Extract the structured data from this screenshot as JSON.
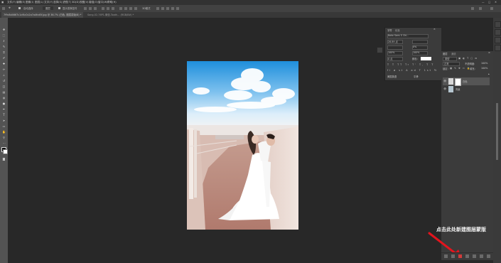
{
  "menubar": {
    "items": [
      "文件(F)",
      "编辑(E)",
      "图像(I)",
      "图层(L)",
      "文字(Y)",
      "选择(S)",
      "滤镜(T)",
      "3D(D)",
      "视图(V)",
      "增强(O)",
      "窗口(W)",
      "帮助(H)"
    ]
  },
  "options": {
    "auto_select_label": "自动选择",
    "layer_label": "图层",
    "transform_label": "显示变换控件",
    "mode_label": "3D模式"
  },
  "tabs": [
    {
      "label": "7f9c8d4667c1cf4c0c2a7a4fcd5f.jpg @ 36.7% (白色, 图层蒙版/8) *",
      "active": true
    },
    {
      "label": "Song-02-76P1-微信-Tooth... (RGB/8#) *",
      "active": false
    }
  ],
  "char_panel": {
    "tab1": "字符",
    "tab2": "段落",
    "font_value": "Noto Sans S Chi...",
    "size_value": "28.89 点",
    "leading_value": "0%",
    "tracking_value": "100%",
    "scale_value": "100%",
    "baseline_value": "0 点",
    "color_label": "颜色:",
    "lang_value": "美国英语",
    "aa_value": "平滑"
  },
  "layers_panel": {
    "tab_layers": "图层",
    "tab_paths": "通道",
    "kind_label": "类型",
    "blend_mode": "正常",
    "opacity_label": "不透明度:",
    "opacity_value": "100%",
    "lock_label": "锁定:",
    "fill_label": "填充:",
    "fill_value": "100%",
    "layers": [
      {
        "name": "白色",
        "selected": true
      },
      {
        "name": "背景",
        "selected": false
      }
    ]
  },
  "annotation": {
    "text": "点击此处新建图层蒙版"
  },
  "colors": {
    "accent_arrow": "#e3141d",
    "canvas_bg": "#282828",
    "panel_bg": "#3b3b3b"
  }
}
